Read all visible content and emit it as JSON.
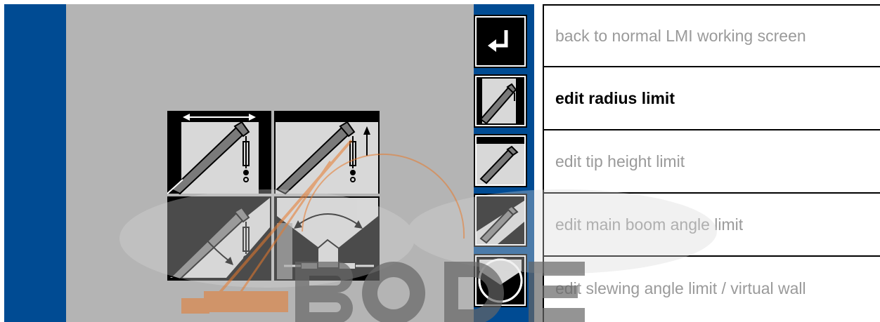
{
  "legend": {
    "items": [
      {
        "label": "back to normal LMI working screen"
      },
      {
        "label": "edit radius limit"
      },
      {
        "label": "edit tip height limit"
      },
      {
        "label": "edit main boom angle limit"
      },
      {
        "label": "edit slewing angle limit / virtual wall"
      }
    ],
    "active_index": 1
  },
  "softkeys": [
    {
      "icon": "return-arrow-icon"
    },
    {
      "icon": "radius-limit-icon"
    },
    {
      "icon": "tip-height-limit-icon"
    },
    {
      "icon": "boom-angle-limit-icon"
    },
    {
      "icon": "slewing-limit-icon"
    }
  ],
  "watermark": {
    "text": "BODE"
  },
  "colors": {
    "screen_background": "#b4b4b4",
    "side_strip": "#004b93",
    "legend_inactive_text": "#9a9a9a",
    "legend_active_text": "#000000",
    "watermark_orange": "#e87a2c"
  }
}
